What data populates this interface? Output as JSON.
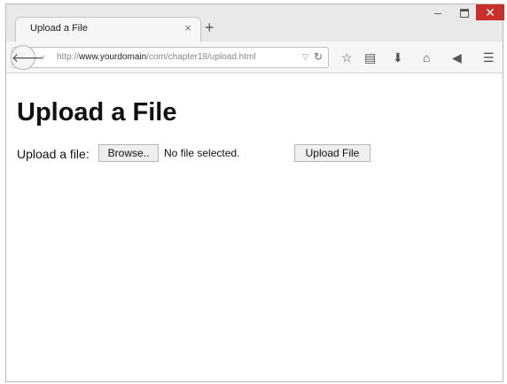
{
  "browser": {
    "tab_title": "Upload a File",
    "tab_close": "×",
    "new_tab": "+",
    "url_prefix": "http://",
    "url_domain": "www.yourdomain",
    "url_path": "/com/chapter18/upload.html",
    "icons": [
      "back-arrow-icon",
      "site-identity-icon",
      "url-dropdown-icon",
      "reload-icon",
      "bookmark-star-icon",
      "reading-list-icon",
      "download-icon",
      "home-icon",
      "send-icon",
      "menu-icon",
      "minimize-icon",
      "maximize-icon",
      "close-icon"
    ]
  },
  "page": {
    "title": "Upload a File",
    "upload_label": "Upload a file:",
    "browse_label": "Browse..",
    "file_status": "No file selected.",
    "upload_button": "Upload File"
  },
  "colors": {
    "close_button": "#c9302c",
    "titlebar": "#e9e9e9"
  }
}
